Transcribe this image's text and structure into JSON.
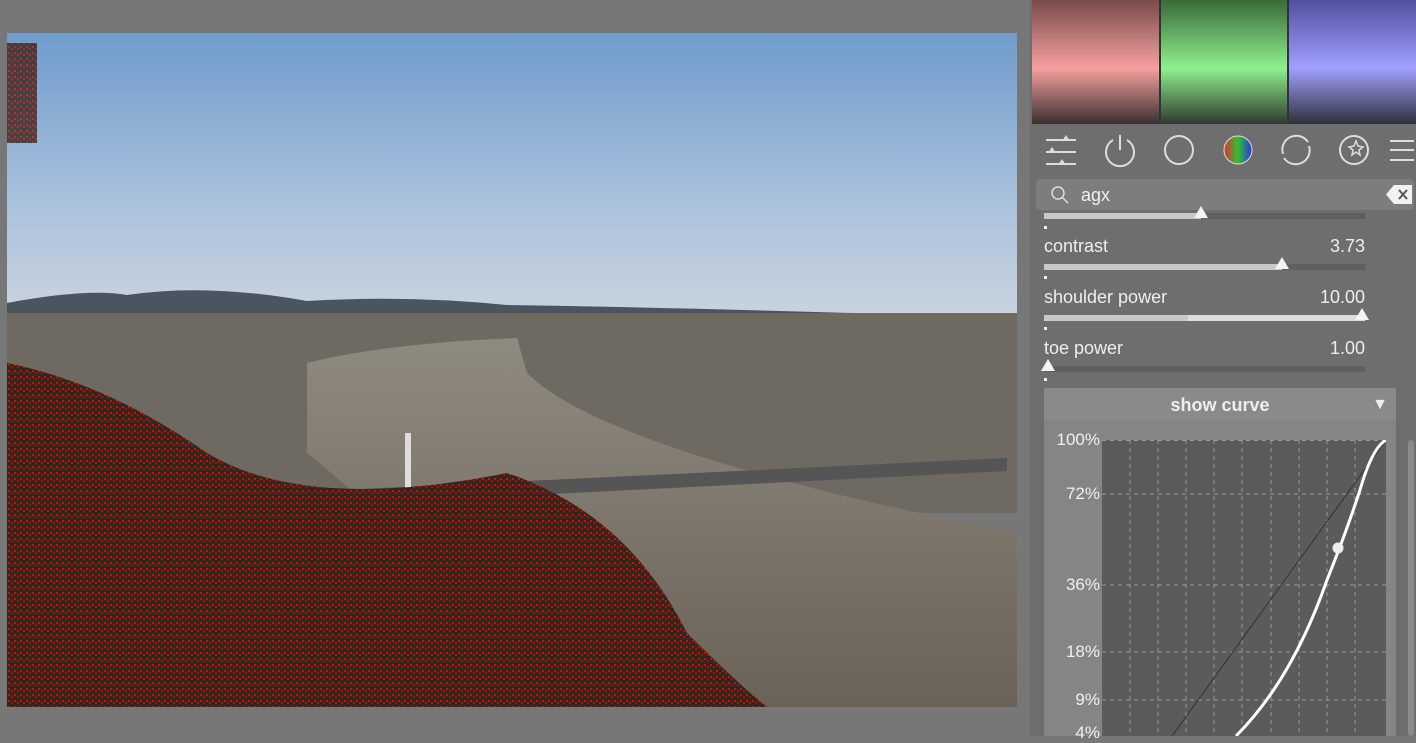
{
  "toolbar": {
    "icons": [
      "sliders-icon",
      "power-icon",
      "circle-icon",
      "color-icon",
      "refresh-icon",
      "effects-icon",
      "menu-icon"
    ]
  },
  "search": {
    "value": "agx"
  },
  "sliders": [
    {
      "label": "contrast",
      "value": "3.73",
      "fraction": 0.74
    },
    {
      "label": "shoulder power",
      "value": "10.00",
      "fraction": 1.0
    },
    {
      "label": "toe power",
      "value": "1.00",
      "fraction": 0.0
    }
  ],
  "top_slider_fraction": 0.49,
  "curve": {
    "header": "show curve",
    "y_labels": [
      "100%",
      "72%",
      "36%",
      "18%",
      "9%",
      "4%"
    ]
  },
  "colors": {
    "accent_red": "#ff0000",
    "curve": "#ffffff"
  }
}
